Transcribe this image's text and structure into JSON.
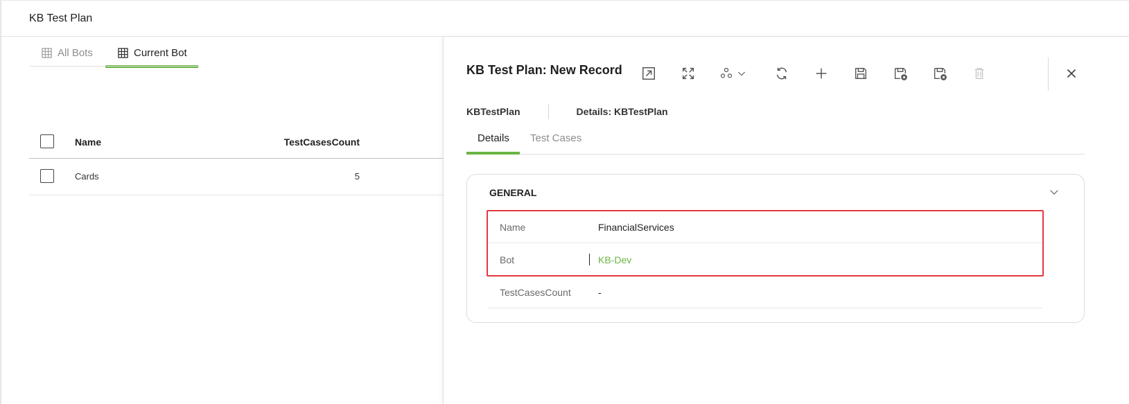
{
  "app": {
    "title": "KB Test Plan"
  },
  "list": {
    "tabs": [
      {
        "label": "All Bots",
        "icon": "grid-icon"
      },
      {
        "label": "Current Bot",
        "icon": "grid-icon"
      }
    ],
    "columns": {
      "name": "Name",
      "count": "TestCasesCount"
    },
    "rows": [
      {
        "name": "Cards",
        "count": "5"
      }
    ]
  },
  "panel": {
    "title": "KB Test Plan: New Record",
    "toolbar": [
      "open-in-new-icon",
      "expand-icon",
      "workflow-icon",
      "refresh-icon",
      "add-icon",
      "save-icon",
      "save-and-new-icon",
      "save-and-close-icon",
      "delete-icon",
      "close-icon"
    ],
    "breadcrumb": {
      "entity": "KBTestPlan",
      "details": "Details: KBTestPlan"
    },
    "tabs": {
      "details": "Details",
      "test_cases": "Test Cases"
    },
    "section": {
      "title": "GENERAL",
      "fields": [
        {
          "label": "Name",
          "value": "FinancialServices"
        },
        {
          "label": "Bot",
          "value": "KB-Dev"
        },
        {
          "label": "TestCasesCount",
          "value": "-"
        }
      ]
    }
  },
  "colors": {
    "accent": "#6bb543",
    "highlight": "#e4383f"
  }
}
